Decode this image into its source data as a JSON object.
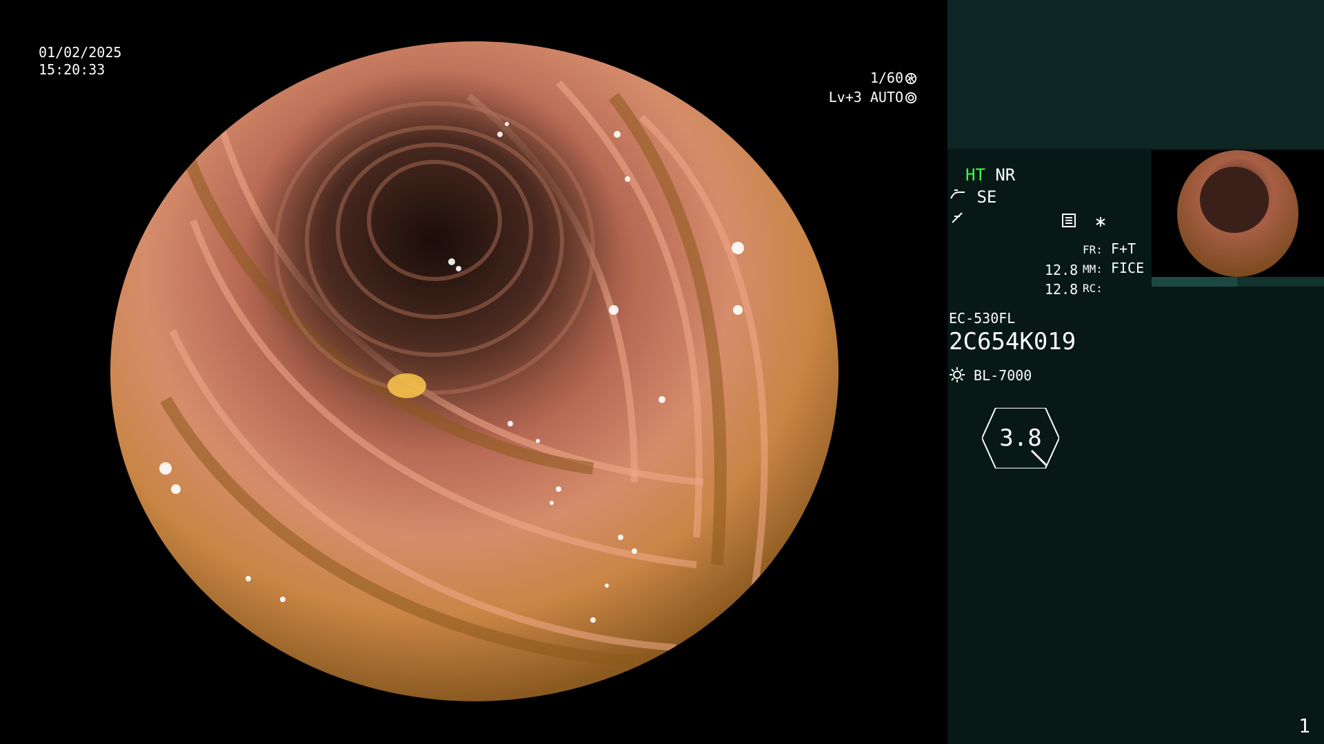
{
  "overlay": {
    "date": "01/02/2025",
    "time": "15:20:33",
    "shutter": "1/60",
    "level": "Lv+3",
    "mode": "AUTO"
  },
  "panel": {
    "ht": "HT",
    "nr": "NR",
    "se": "SE",
    "magnification": "3.8",
    "val1": "12.8",
    "val2": "12.8",
    "fr_label": "FR:",
    "fr_value": "F+T",
    "mm_label": "MM:",
    "mm_value": "FICE",
    "rc_label": "RC:",
    "scope_model": "EC-530FL",
    "serial": "2C654K019",
    "light_source": "BL-7000",
    "page_number": "1",
    "icons": [
      "scope-icon",
      "wave-icon",
      "menu-icon",
      "asterisk-icon",
      "sun-icon",
      "shutter-icon",
      "iris-icon"
    ]
  },
  "colors": {
    "panel_bg": "#071816",
    "panel_top_bg": "#0d2623",
    "ht_green": "#41ff41"
  }
}
